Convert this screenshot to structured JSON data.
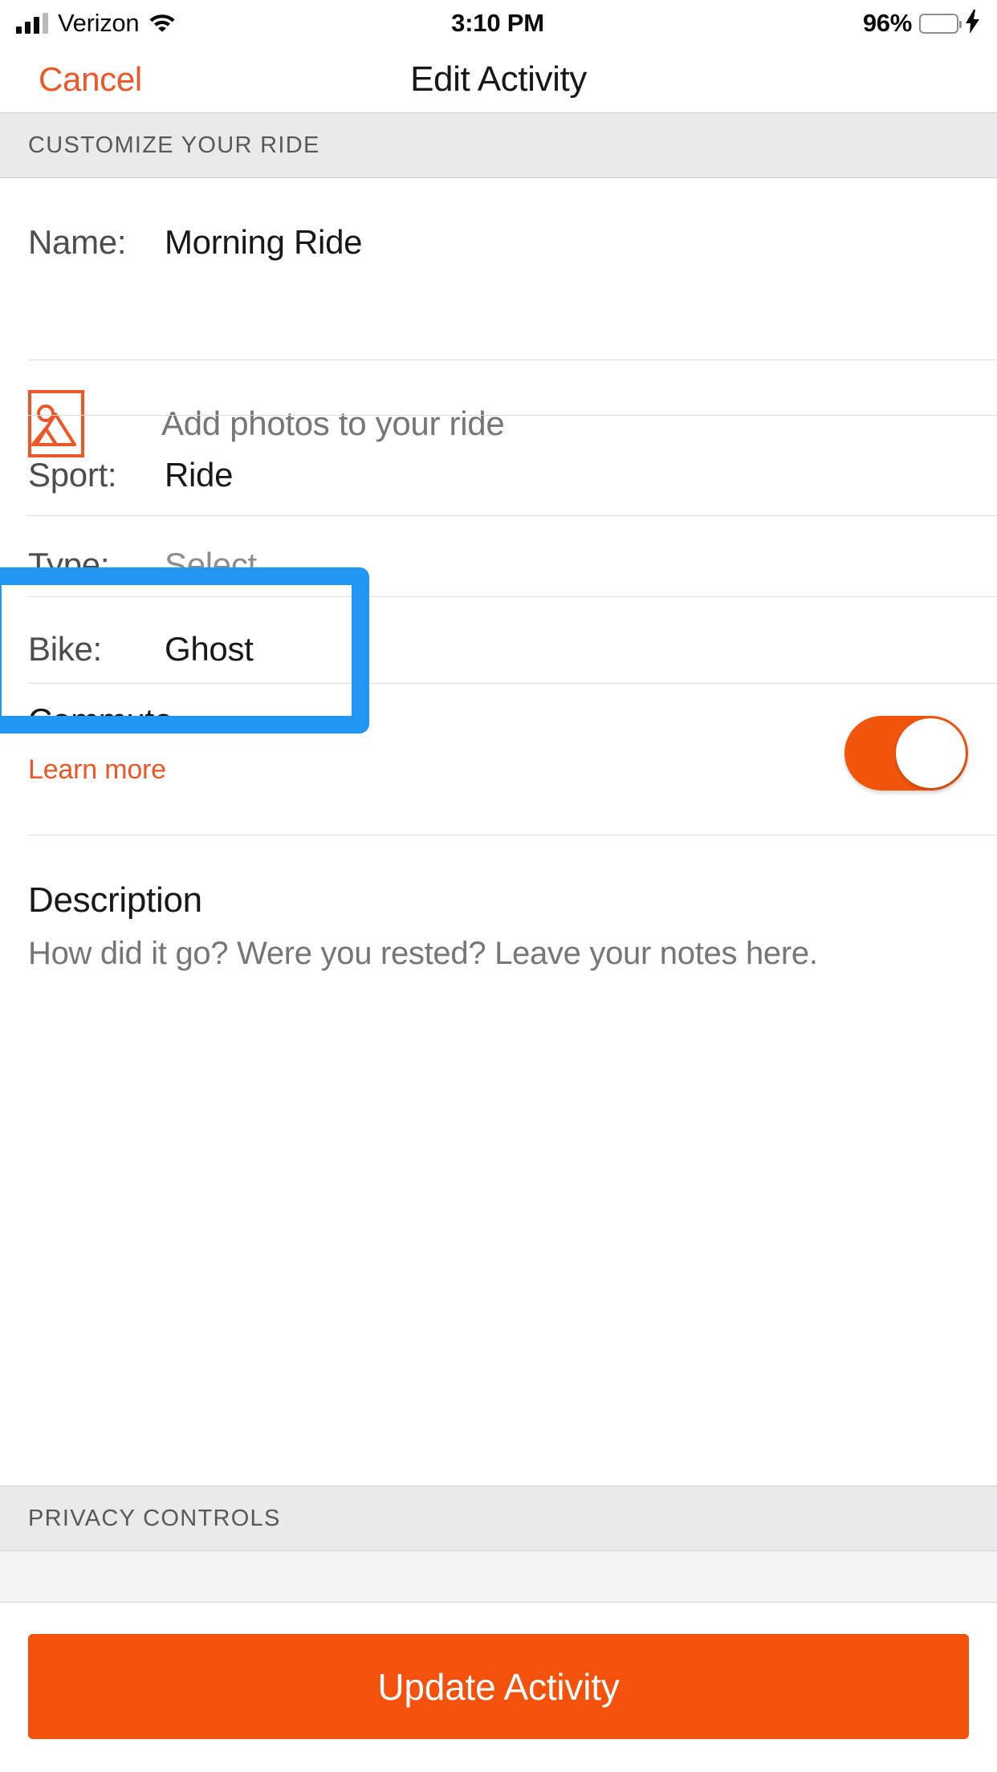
{
  "status_bar": {
    "carrier": "Verizon",
    "time": "3:10 PM",
    "battery_percent": "96%",
    "wifi_icon": "wifi-icon",
    "signal_icon": "cellular-signal-icon",
    "battery_icon": "battery-icon",
    "charging_icon": "lightning-bolt-icon"
  },
  "nav": {
    "cancel_label": "Cancel",
    "title": "Edit Activity"
  },
  "sections": {
    "customize_header": "CUSTOMIZE YOUR RIDE",
    "privacy_header": "PRIVACY CONTROLS"
  },
  "fields": {
    "name": {
      "label": "Name:",
      "value": "Morning Ride"
    },
    "photos": {
      "label": "Add photos to your ride",
      "icon": "photo-placeholder-icon"
    },
    "sport": {
      "label": "Sport:",
      "value": "Ride"
    },
    "type": {
      "label": "Type:",
      "value": "Select",
      "is_placeholder": true
    },
    "bike": {
      "label": "Bike:",
      "value": "Ghost"
    },
    "commute": {
      "label": "Commute",
      "learn_more": "Learn more",
      "toggle_state": "on"
    },
    "description": {
      "title": "Description",
      "placeholder": "How did it go? Were you rested? Leave your notes here."
    }
  },
  "footer": {
    "update_label": "Update Activity"
  },
  "colors": {
    "accent_orange": "#ef5525",
    "button_orange": "#f4510c",
    "toggle_on": "#f3540c",
    "annotation_blue": "#2196f3",
    "section_gray": "#eaeaec",
    "battery_green": "#4cd662"
  }
}
